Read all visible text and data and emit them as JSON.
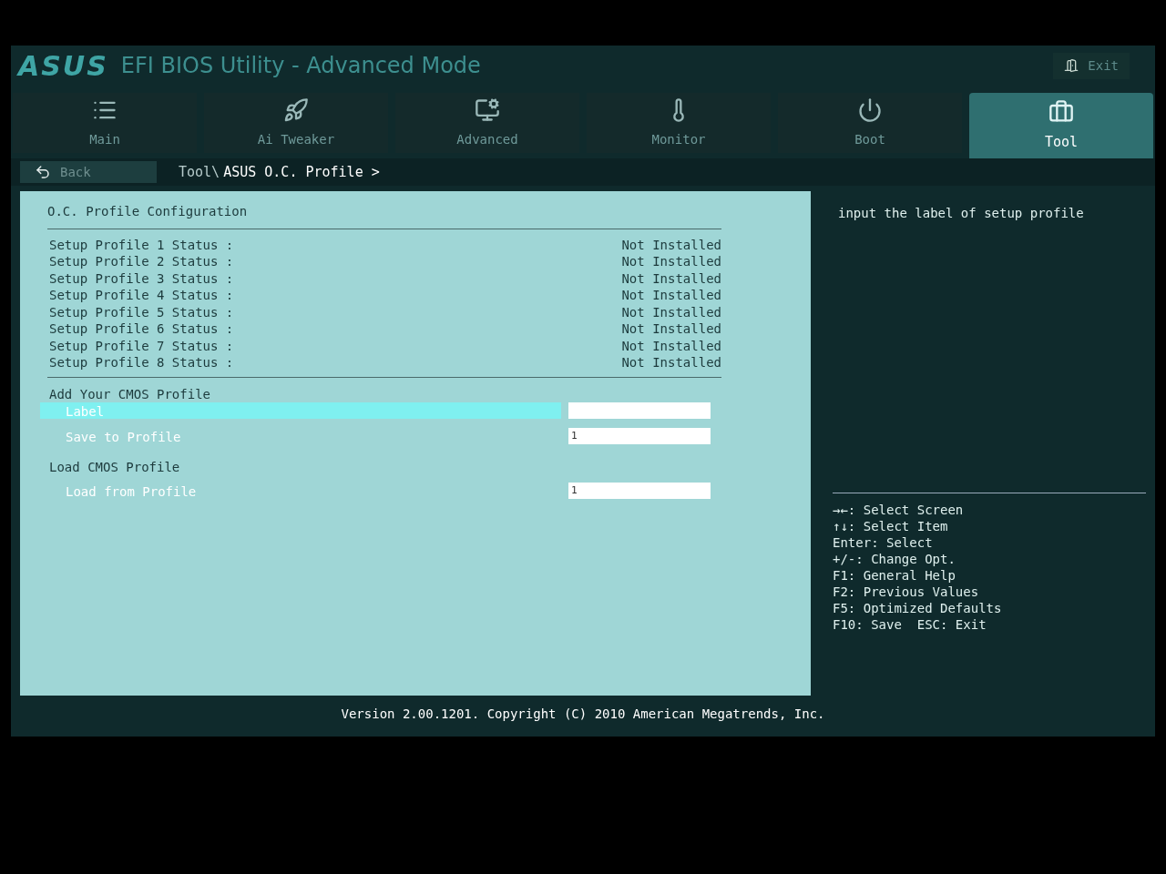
{
  "header": {
    "logo": "ASUS",
    "title": "EFI BIOS Utility - Advanced Mode",
    "exit": "Exit"
  },
  "tabs": [
    {
      "label": "Main",
      "selected": false
    },
    {
      "label": "Ai Tweaker",
      "selected": false
    },
    {
      "label": "Advanced",
      "selected": false
    },
    {
      "label": "Monitor",
      "selected": false
    },
    {
      "label": "Boot",
      "selected": false
    },
    {
      "label": "Tool",
      "selected": true
    }
  ],
  "breadcrumb": {
    "back": "Back",
    "path": "Tool\\",
    "current": "ASUS O.C. Profile >"
  },
  "panel": {
    "section_title": "O.C. Profile Configuration",
    "statuses": [
      {
        "label": "Setup Profile 1 Status :",
        "value": "Not Installed"
      },
      {
        "label": "Setup Profile 2 Status :",
        "value": "Not Installed"
      },
      {
        "label": "Setup Profile 3 Status :",
        "value": "Not Installed"
      },
      {
        "label": "Setup Profile 4 Status :",
        "value": "Not Installed"
      },
      {
        "label": "Setup Profile 5 Status :",
        "value": "Not Installed"
      },
      {
        "label": "Setup Profile 6 Status :",
        "value": "Not Installed"
      },
      {
        "label": "Setup Profile 7 Status :",
        "value": "Not Installed"
      },
      {
        "label": "Setup Profile 8 Status :",
        "value": "Not Installed"
      }
    ],
    "items": [
      {
        "kind": "heading",
        "label": "Add Your CMOS Profile"
      },
      {
        "kind": "field",
        "label": "Label",
        "selected": true
      },
      {
        "kind": "field",
        "label": "Save to Profile",
        "value": "1",
        "selected": false
      },
      {
        "kind": "heading",
        "label": "Load CMOS Profile"
      },
      {
        "kind": "field",
        "label": "Load from Profile",
        "value": "1",
        "selected": false
      }
    ]
  },
  "help": {
    "text": "input the label of setup profile",
    "keys": [
      "→←: Select Screen",
      "↑↓: Select Item",
      "Enter: Select",
      "+/-: Change Opt.",
      "F1: General Help",
      "F2: Previous Values",
      "F5: Optimized Defaults",
      "F10: Save  ESC: Exit"
    ]
  },
  "footer": "Version 2.00.1201. Copyright (C) 2010 American Megatrends, Inc."
}
